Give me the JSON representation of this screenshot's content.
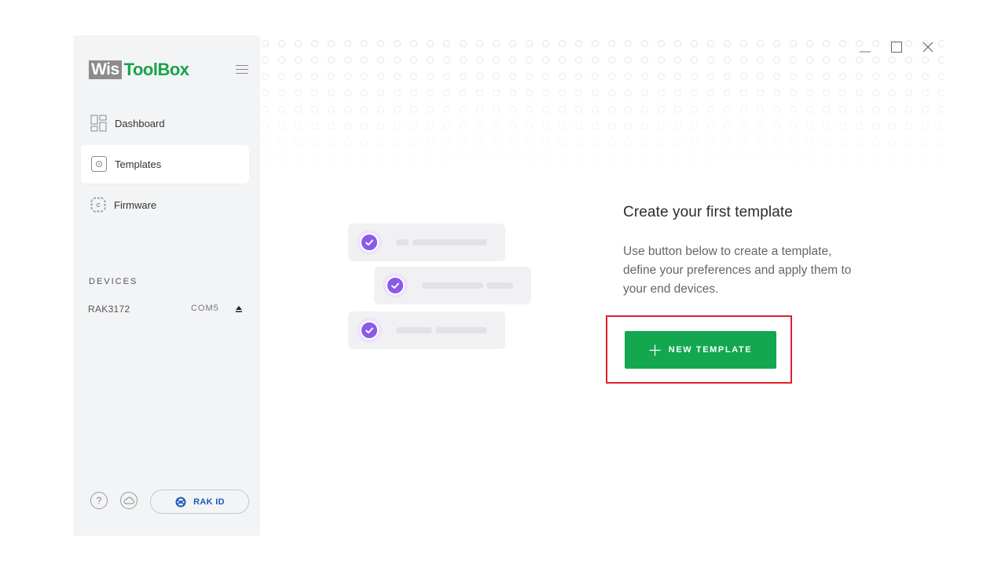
{
  "app": {
    "logo_left": "Wis",
    "logo_right": "ToolBox"
  },
  "sidebar": {
    "items": [
      {
        "label": "Dashboard",
        "icon": "dashboard-icon"
      },
      {
        "label": "Templates",
        "icon": "templates-icon",
        "active": true
      },
      {
        "label": "Firmware",
        "icon": "firmware-chip-icon"
      }
    ],
    "devices_title": "DEVICES",
    "devices": [
      {
        "name": "RAK3172",
        "port": "COM5"
      }
    ],
    "footer": {
      "help_symbol": "?",
      "rakid_label": "RAK ID"
    }
  },
  "main": {
    "title": "Create your first template",
    "description": "Use button below to create a template, define your preferences and apply them to your end devices.",
    "new_template_label": "NEW TEMPLATE"
  },
  "colors": {
    "accent_green": "#13a750",
    "logo_green": "#1aa34a",
    "check_purple": "#8a5ae8",
    "highlight_red": "#e0202a",
    "rakid_blue": "#1d5ab8"
  }
}
